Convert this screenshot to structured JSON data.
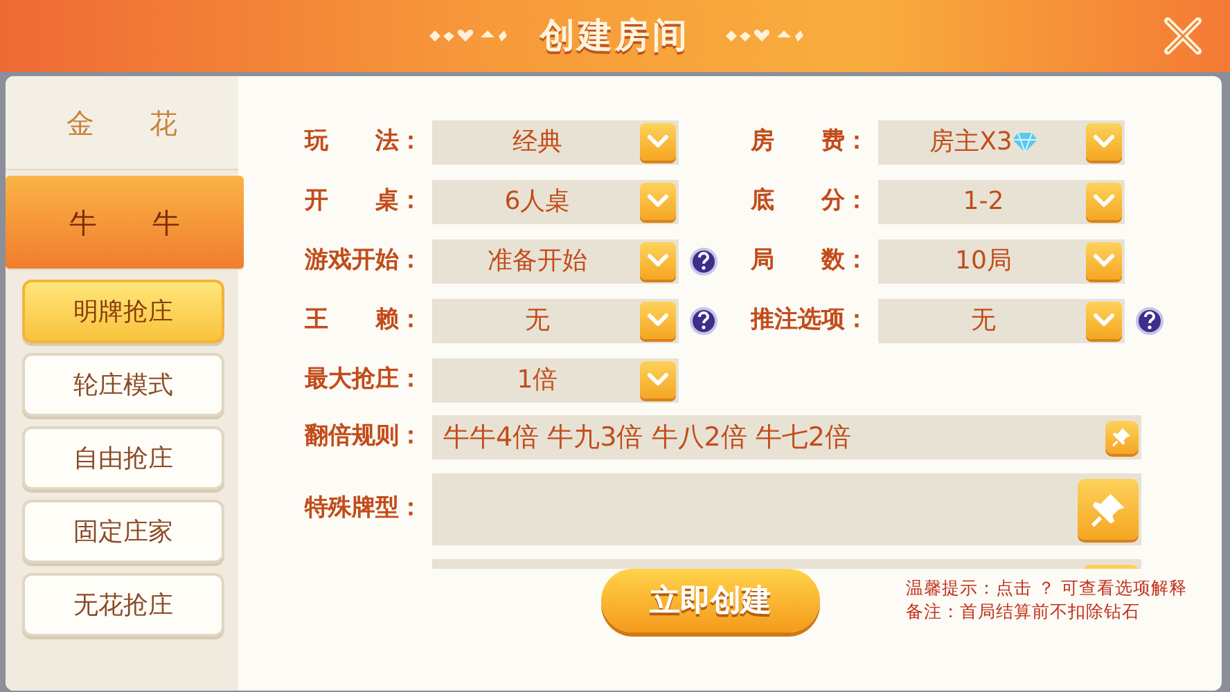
{
  "title": "创建房间",
  "categories": [
    {
      "label": "金花",
      "selected": false
    },
    {
      "label": "牛牛",
      "selected": true
    }
  ],
  "modes": [
    {
      "label": "明牌抢庄",
      "selected": true
    },
    {
      "label": "轮庄模式",
      "selected": false
    },
    {
      "label": "自由抢庄",
      "selected": false
    },
    {
      "label": "固定庄家",
      "selected": false
    },
    {
      "label": "无花抢庄",
      "selected": false
    }
  ],
  "rows": [
    {
      "left": {
        "label": "玩　　法：",
        "value": "经典",
        "help": false
      },
      "right": {
        "label": "房　　费：",
        "value": "房主X3",
        "help": false,
        "kind": "diamond"
      }
    },
    {
      "left": {
        "label": "开　　桌：",
        "value": "6人桌",
        "help": false
      },
      "right": {
        "label": "底　　分：",
        "value": "1-2",
        "help": false
      }
    },
    {
      "left": {
        "label": "游戏开始：",
        "value": "准备开始",
        "help": true
      },
      "right": {
        "label": "局　　数：",
        "value": "10局",
        "help": false
      }
    },
    {
      "left": {
        "label": "王　　赖：",
        "value": "无",
        "help": true
      },
      "right": {
        "label": "推注选项：",
        "value": "无",
        "help": true
      }
    },
    {
      "left": {
        "label": "最大抢庄：",
        "value": "1倍",
        "help": false
      }
    }
  ],
  "text_rows": [
    {
      "kind": "rule",
      "label": "翻倍规则：",
      "value": "牛牛4倍 牛九3倍 牛八2倍 牛七2倍"
    },
    {
      "kind": "special",
      "label": "特殊牌型："
    },
    {
      "kind": "partial"
    }
  ],
  "create_button": "立即创建",
  "hints": [
    "温馨提示：点击 ？ 可查看选项解释",
    "备注：首局结算前不扣除钻石"
  ]
}
